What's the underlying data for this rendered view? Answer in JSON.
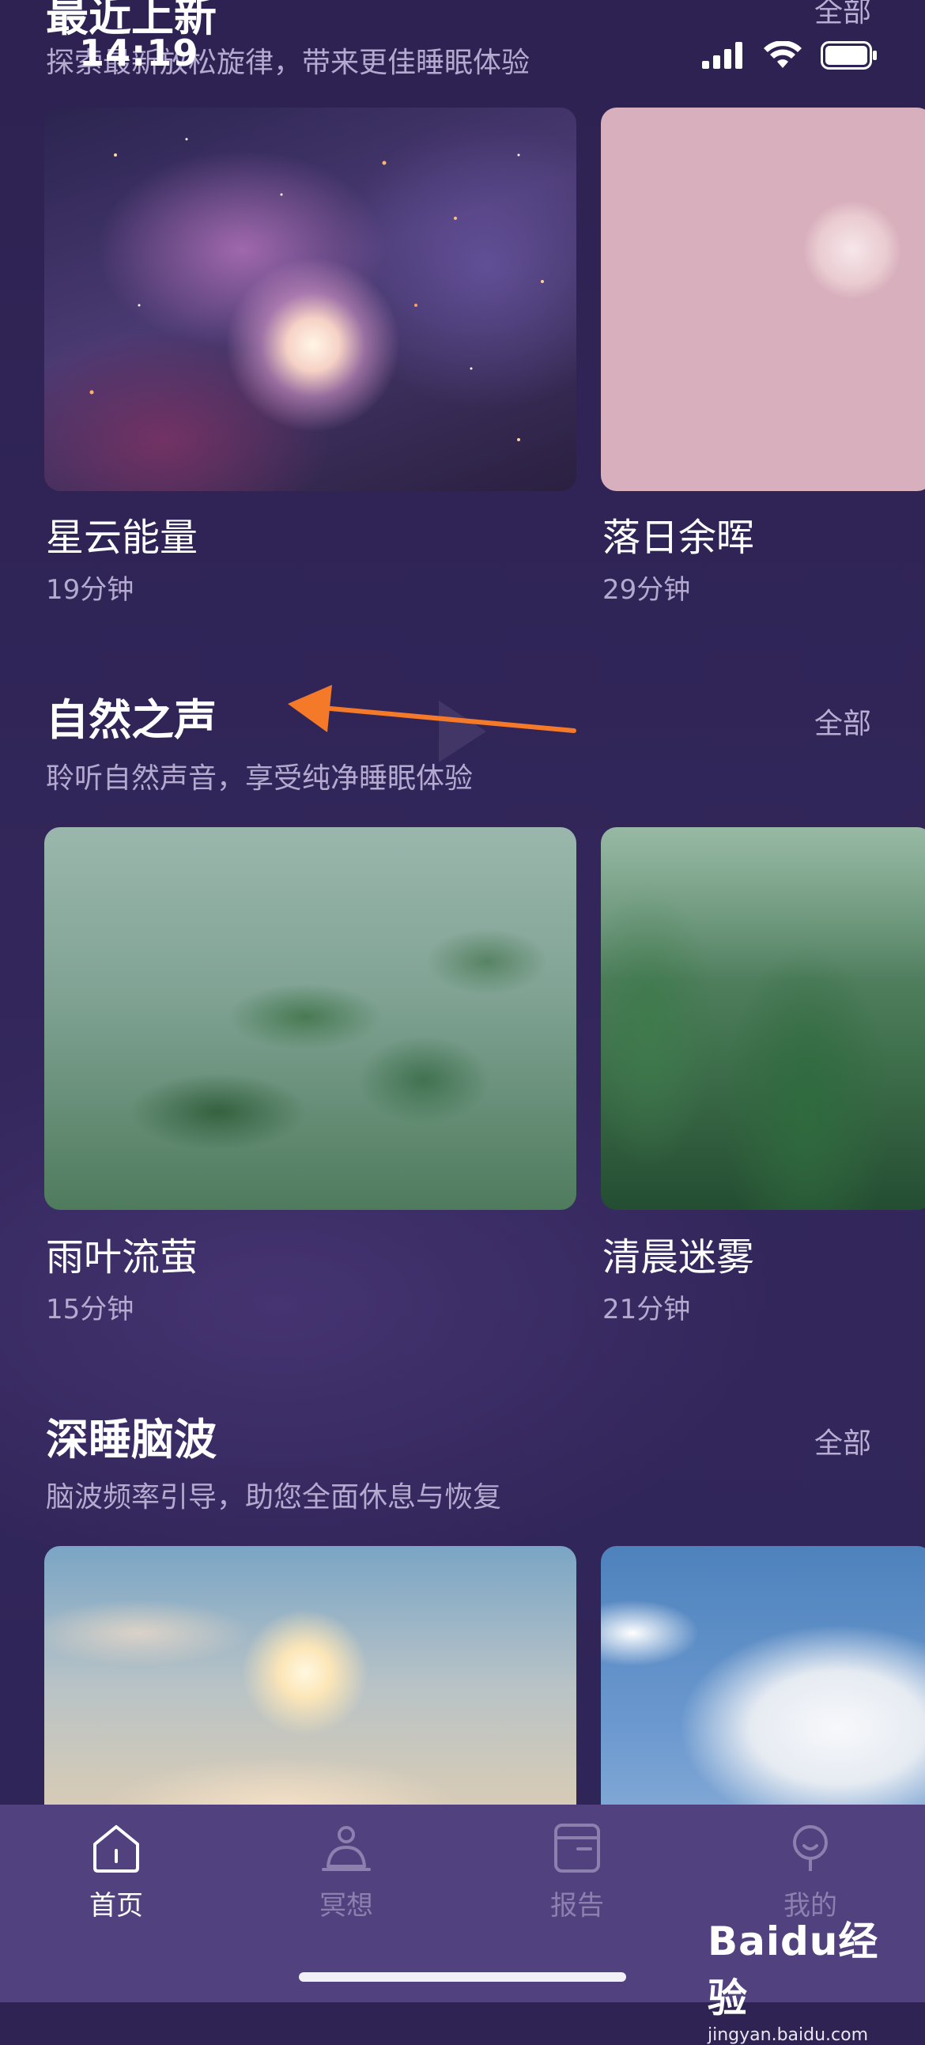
{
  "status_bar": {
    "time": "14:19"
  },
  "sections": [
    {
      "title": "最近上新",
      "subtitle": "探索最新放松旋律，带来更佳睡眠体验",
      "see_all": "全部",
      "cards": [
        {
          "title": "星云能量",
          "duration": "19分钟"
        },
        {
          "title": "落日余晖",
          "duration": "29分钟"
        }
      ]
    },
    {
      "title": "自然之声",
      "subtitle": "聆听自然声音，享受纯净睡眠体验",
      "see_all": "全部",
      "cards": [
        {
          "title": "雨叶流萤",
          "duration": "15分钟"
        },
        {
          "title": "清晨迷雾",
          "duration": "21分钟"
        }
      ]
    },
    {
      "title": "深睡脑波",
      "subtitle": "脑波频率引导，助您全面休息与恢复",
      "see_all": "全部",
      "cards": [
        {
          "title": "",
          "duration": ""
        },
        {
          "title": "",
          "duration": ""
        }
      ]
    }
  ],
  "tab_bar": {
    "tabs": [
      {
        "label": "首页",
        "icon": "home-icon",
        "active": true
      },
      {
        "label": "冥想",
        "icon": "meditation-icon",
        "active": false
      },
      {
        "label": "报告",
        "icon": "report-icon",
        "active": false
      },
      {
        "label": "我的",
        "icon": "profile-icon",
        "active": false
      }
    ]
  },
  "annotation": {
    "arrow_color": "#f47a2a"
  },
  "watermark": {
    "logo": "Baidu经验",
    "url": "jingyan.baidu.com"
  },
  "colors": {
    "background": "#2e2353",
    "tab_bar": "#51427f",
    "secondary_text": "#b4a9cf"
  }
}
